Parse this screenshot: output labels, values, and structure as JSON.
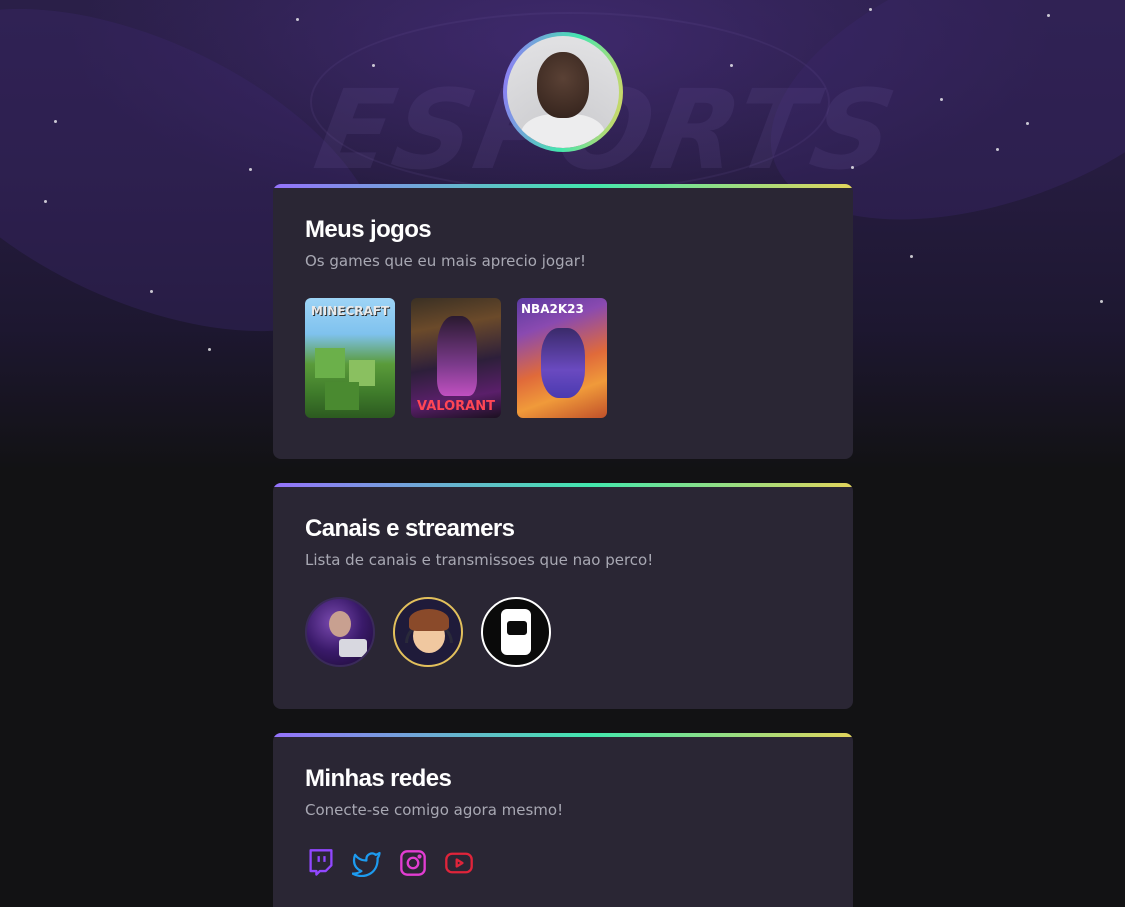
{
  "profile": {
    "avatar_alt": "profile photo"
  },
  "games_card": {
    "title": "Meus jogos",
    "subtitle": "Os games que eu mais aprecio jogar!",
    "games": [
      {
        "name": "MINECRAFT",
        "icon": "minecraft-cover"
      },
      {
        "name": "VALORANT",
        "icon": "valorant-cover"
      },
      {
        "name": "NBA2K23",
        "icon": "nba2k23-cover"
      }
    ]
  },
  "channels_card": {
    "title": "Canais e streamers",
    "subtitle": "Lista de canais e transmissoes que nao perco!",
    "channels": [
      {
        "icon": "streamer-avatar"
      },
      {
        "icon": "streamer-avatar"
      },
      {
        "icon": "channel-logo"
      }
    ]
  },
  "social_card": {
    "title": "Minhas redes",
    "subtitle": "Conecte-se comigo agora mesmo!",
    "links": [
      {
        "icon": "twitch-icon",
        "color": "#9147ff"
      },
      {
        "icon": "twitter-icon",
        "color": "#1d9bf0"
      },
      {
        "icon": "instagram-icon",
        "color": "#e23dd2"
      },
      {
        "icon": "youtube-icon",
        "color": "#e0243a"
      }
    ]
  },
  "theme": {
    "background": "#121214",
    "card": "#2a2634",
    "gradient": [
      "#9572fc",
      "#43e7ad",
      "#e2d45c"
    ],
    "text_muted": "#a8a8b3"
  }
}
